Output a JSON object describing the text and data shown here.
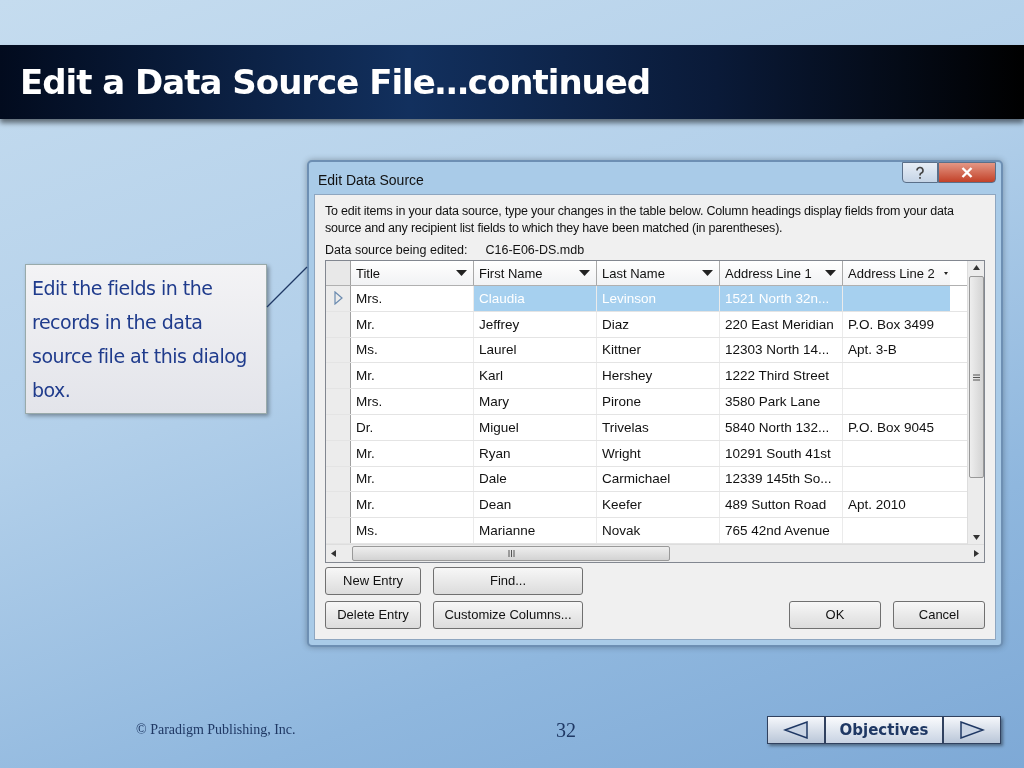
{
  "slide": {
    "title": "Edit a Data Source File…continued",
    "callout": "Edit the fields in the records in the data source file at this dialog box.",
    "dialog": {
      "title": "Edit Data Source",
      "instructions": "To edit items in your data source, type your changes in the table below. Column headings display fields from your data source and any recipient list fields to which they have been matched (in parentheses).",
      "source_label": "Data source being edited:",
      "source_file": "C16-E06-DS.mdb",
      "columns": [
        "Title",
        "First Name",
        "Last Name",
        "Address Line 1",
        "Address Line 2"
      ],
      "rows": [
        {
          "selected": true,
          "title": "Mrs.",
          "first_name": "Claudia",
          "last_name": "Levinson",
          "address_line_1": "1521 North 32n..."
        },
        {
          "selected": false,
          "title": "Mr.",
          "first_name": "Jeffrey",
          "last_name": "Diaz",
          "address_line_1": "220 East Meridian",
          "address_line_2": "P.O. Box 3499"
        },
        {
          "selected": false,
          "title": "Ms.",
          "first_name": "Laurel",
          "last_name": "Kittner",
          "address_line_1": "12303 North 14...",
          "address_line_2": "Apt. 3-B"
        },
        {
          "selected": false,
          "title": "Mr.",
          "first_name": "Karl",
          "last_name": "Hershey",
          "address_line_1": "1222 Third Street"
        },
        {
          "selected": false,
          "title": "Mrs.",
          "first_name": "Mary",
          "last_name": "Pirone",
          "address_line_1": "3580 Park Lane"
        },
        {
          "selected": false,
          "title": "Dr.",
          "first_name": "Miguel",
          "last_name": "Trivelas",
          "address_line_1": "5840 North 132...",
          "address_line_2": "P.O. Box 9045"
        },
        {
          "selected": false,
          "title": "Mr.",
          "first_name": "Ryan",
          "last_name": "Wright",
          "address_line_1": "10291 South 41st"
        },
        {
          "selected": false,
          "title": "Mr.",
          "first_name": "Dale",
          "last_name": "Carmichael",
          "address_line_1": "12339 145th So..."
        },
        {
          "selected": false,
          "title": "Mr.",
          "first_name": "Dean",
          "last_name": "Keefer",
          "address_line_1": "489 Sutton Road",
          "address_line_2": "Apt. 2010"
        },
        {
          "selected": false,
          "title": "Ms.",
          "first_name": "Marianne",
          "last_name": "Novak",
          "address_line_1": "765 42nd Avenue"
        }
      ],
      "record_buttons": [
        "New Entry",
        "Find...",
        "Delete Entry",
        "Customize Columns..."
      ],
      "dialog_buttons": [
        "OK",
        "Cancel"
      ]
    },
    "footer": {
      "copyright": "© Paradigm Publishing, Inc.",
      "page": "32",
      "nav_label": "Objectives"
    }
  }
}
